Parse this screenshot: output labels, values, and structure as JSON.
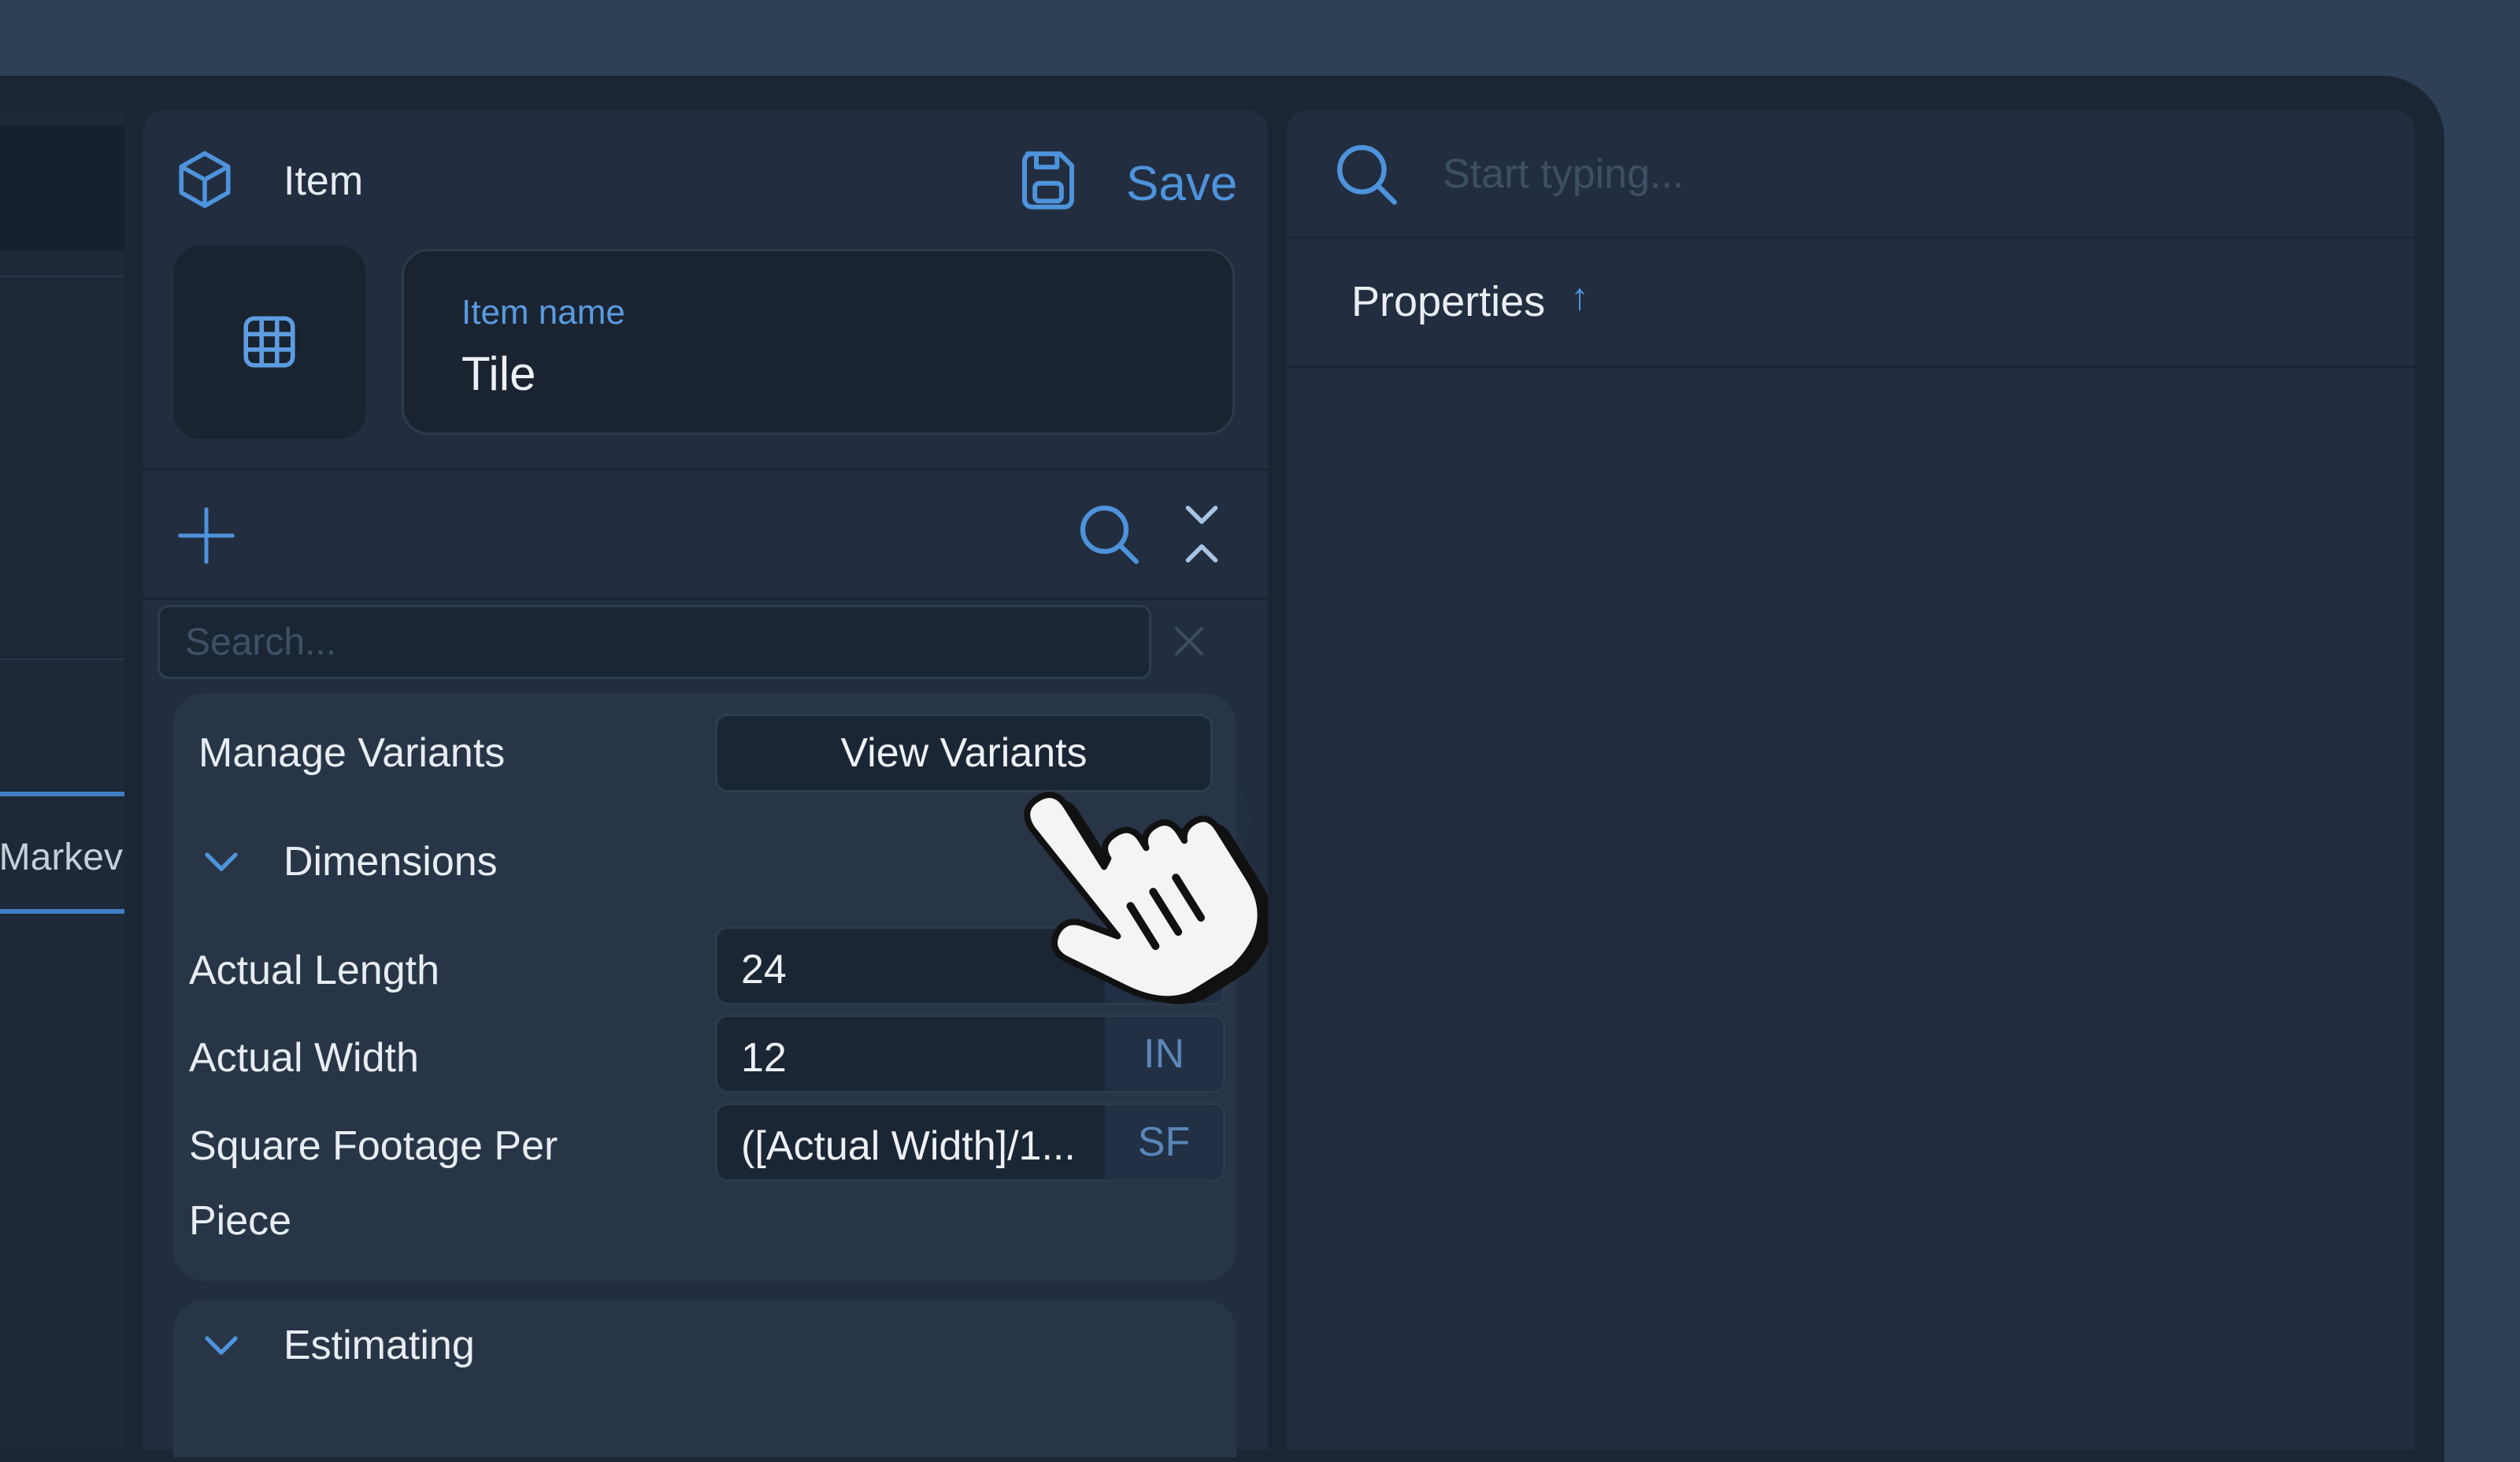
{
  "item_header": {
    "title": "Item",
    "save_label": "Save"
  },
  "item_name": {
    "label": "Item name",
    "value": "Tile"
  },
  "left_panel": {
    "tab_label": "Markev"
  },
  "search": {
    "placeholder": "Search..."
  },
  "variants": {
    "label": "Manage Variants",
    "button_label": "View Variants"
  },
  "sections": {
    "dimensions": "Dimensions",
    "estimating": "Estimating"
  },
  "fields": [
    {
      "label": "Actual Length",
      "value": "24",
      "unit": ""
    },
    {
      "label": "Actual Width",
      "value": "12",
      "unit": "IN"
    },
    {
      "label_line1": "Square Footage Per",
      "label_line2": "Piece",
      "value": "([Actual Width]/1...",
      "unit": "SF"
    }
  ],
  "right_panel": {
    "search_placeholder": "Start typing...",
    "header": "Properties"
  },
  "icons": {
    "item": "cube-icon",
    "save": "save-icon",
    "thumbnail": "grid-icon",
    "add": "plus-icon",
    "search": "search-icon",
    "collapse": "collapse-icon",
    "clear": "close-icon",
    "chevron": "chevron-down-icon",
    "sort": "arrow-up-icon",
    "cursor": "pointer-hand-icon"
  },
  "colors": {
    "accent": "#4e93dc",
    "background": "#1b2635",
    "panel": "#222e3f"
  }
}
